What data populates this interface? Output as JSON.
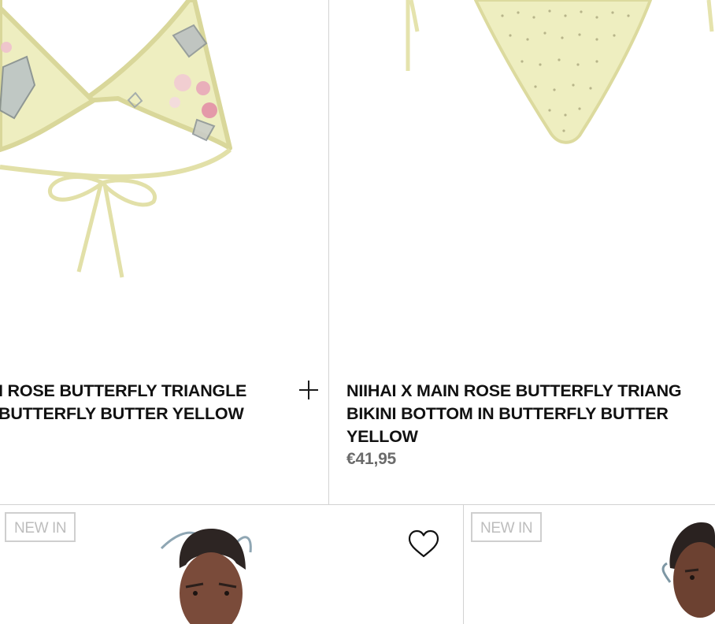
{
  "products_top": [
    {
      "title_line1": "I ROSE BUTTERFLY TRIANGLE",
      "title_line2": " BUTTERFLY BUTTER YELLOW",
      "add_icon": "plus-icon"
    },
    {
      "title_line1": "NIIHAI X MAIN ROSE BUTTERFLY TRIANG",
      "title_line2": "BIKINI BOTTOM IN BUTTERFLY BUTTER",
      "title_line3": "YELLOW",
      "price": "€41,95"
    }
  ],
  "products_bottom": [
    {
      "badge": "NEW IN",
      "wishlist_icon": "heart-icon"
    },
    {
      "badge": "NEW IN"
    }
  ],
  "colors": {
    "fabric": "#eeeec0",
    "fabric_edge": "#d9d79a",
    "divider": "#d2d2d2",
    "price": "#6b6b6b",
    "badge_text": "#bdbdbd"
  }
}
